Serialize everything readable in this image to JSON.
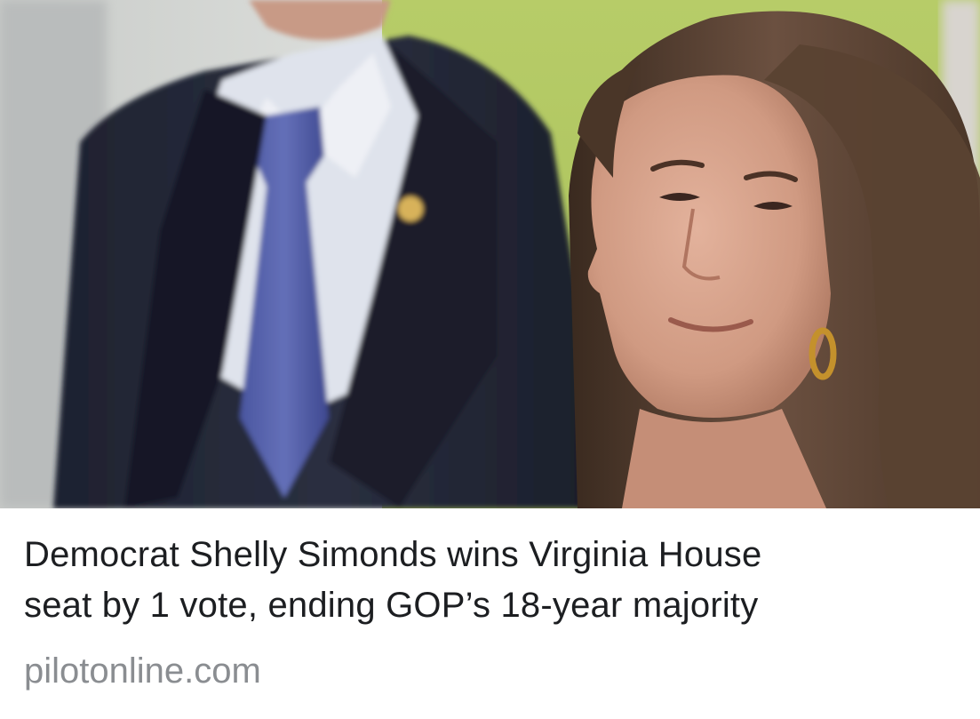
{
  "link_preview": {
    "headline_line1": "Democrat Shelly Simonds wins Virginia House",
    "headline_line2": "seat by 1 vote, ending GOP’s 18-year majority",
    "domain": "pilotonline.com"
  },
  "photo": {
    "subject": "photo-woman-smiling-man-in-suit-background"
  },
  "colors": {
    "headline": "#1c1e21",
    "domain": "#8a8d91",
    "background": "#ffffff"
  }
}
